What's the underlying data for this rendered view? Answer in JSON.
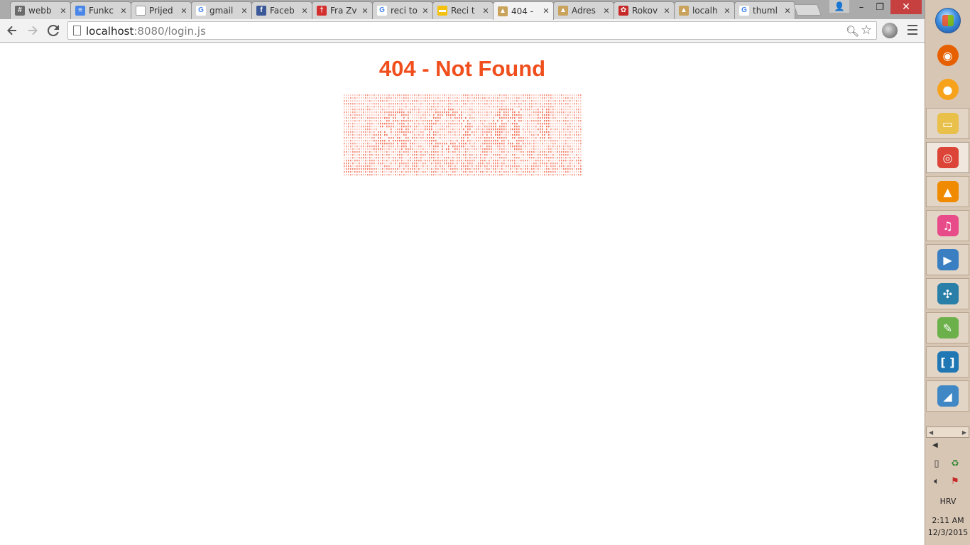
{
  "browser": {
    "tabs": [
      {
        "title": "webb",
        "favicon": "hash-icon",
        "favicon_color": "#6b6b6b",
        "active": false
      },
      {
        "title": "Funkc",
        "favicon": "docs-icon",
        "favicon_color": "#4a86e8",
        "active": false
      },
      {
        "title": "Prijed",
        "favicon": "page-icon",
        "favicon_color": "#9e9e9e",
        "active": false
      },
      {
        "title": "gmail",
        "favicon": "google-icon",
        "favicon_color": "#4285f4",
        "active": false
      },
      {
        "title": "Faceb",
        "favicon": "facebook-icon",
        "favicon_color": "#3b5998",
        "active": false
      },
      {
        "title": "Fra Zv",
        "favicon": "red-flag-icon",
        "favicon_color": "#d32f2f",
        "active": false
      },
      {
        "title": "reci to",
        "favicon": "google-icon",
        "favicon_color": "#4285f4",
        "active": false
      },
      {
        "title": "Reci t",
        "favicon": "speech-bubble-icon",
        "favicon_color": "#f4c20d",
        "active": false
      },
      {
        "title": "404 -",
        "favicon": "image-icon",
        "favicon_color": "#c9a35b",
        "active": true
      },
      {
        "title": "Adres",
        "favicon": "image-icon",
        "favicon_color": "#c9a35b",
        "active": false
      },
      {
        "title": "Rokov",
        "favicon": "network-icon",
        "favicon_color": "#c62828",
        "active": false
      },
      {
        "title": "localh",
        "favicon": "image-icon",
        "favicon_color": "#c9a35b",
        "active": false
      },
      {
        "title": "thuml",
        "favicon": "google-icon",
        "favicon_color": "#4285f4",
        "active": false
      }
    ],
    "url_host": "localhost",
    "url_rest": ":8080/login.js",
    "window_controls": {
      "minimize": "–",
      "maximize": "❐",
      "close": "✕"
    }
  },
  "page": {
    "title": "404 - Not Found",
    "title_color": "#f04e1c",
    "ascii_art_color": "#f26a4f"
  },
  "taskbar": {
    "pinned": [
      {
        "name": "firefox",
        "label": "firefox-icon",
        "color": "#e66000"
      },
      {
        "name": "gom-player",
        "label": "gom-player-icon",
        "color": "#f7a21b"
      },
      {
        "name": "file-explorer",
        "label": "folder-icon",
        "color": "#e8c04a"
      },
      {
        "name": "chrome",
        "label": "chrome-icon",
        "color": "#db4437",
        "active": true
      },
      {
        "name": "vlc",
        "label": "vlc-icon",
        "color": "#f08a00"
      },
      {
        "name": "itunes",
        "label": "itunes-icon",
        "color": "#e84b8a"
      },
      {
        "name": "media-player",
        "label": "media-player-icon",
        "color": "#3a7fc2"
      },
      {
        "name": "app-tree",
        "label": "tree-app-icon",
        "color": "#2a7fa8"
      },
      {
        "name": "notepad-plus",
        "label": "notepad-plus-icon",
        "color": "#6bb04a"
      },
      {
        "name": "brackets",
        "label": "brackets-icon",
        "color": "#1f78b4"
      },
      {
        "name": "mysql-installer",
        "label": "mysql-installer-icon",
        "color": "#3f88c5"
      }
    ],
    "language": "HRV",
    "time": "2:11 AM",
    "date": "12/3/2015"
  }
}
